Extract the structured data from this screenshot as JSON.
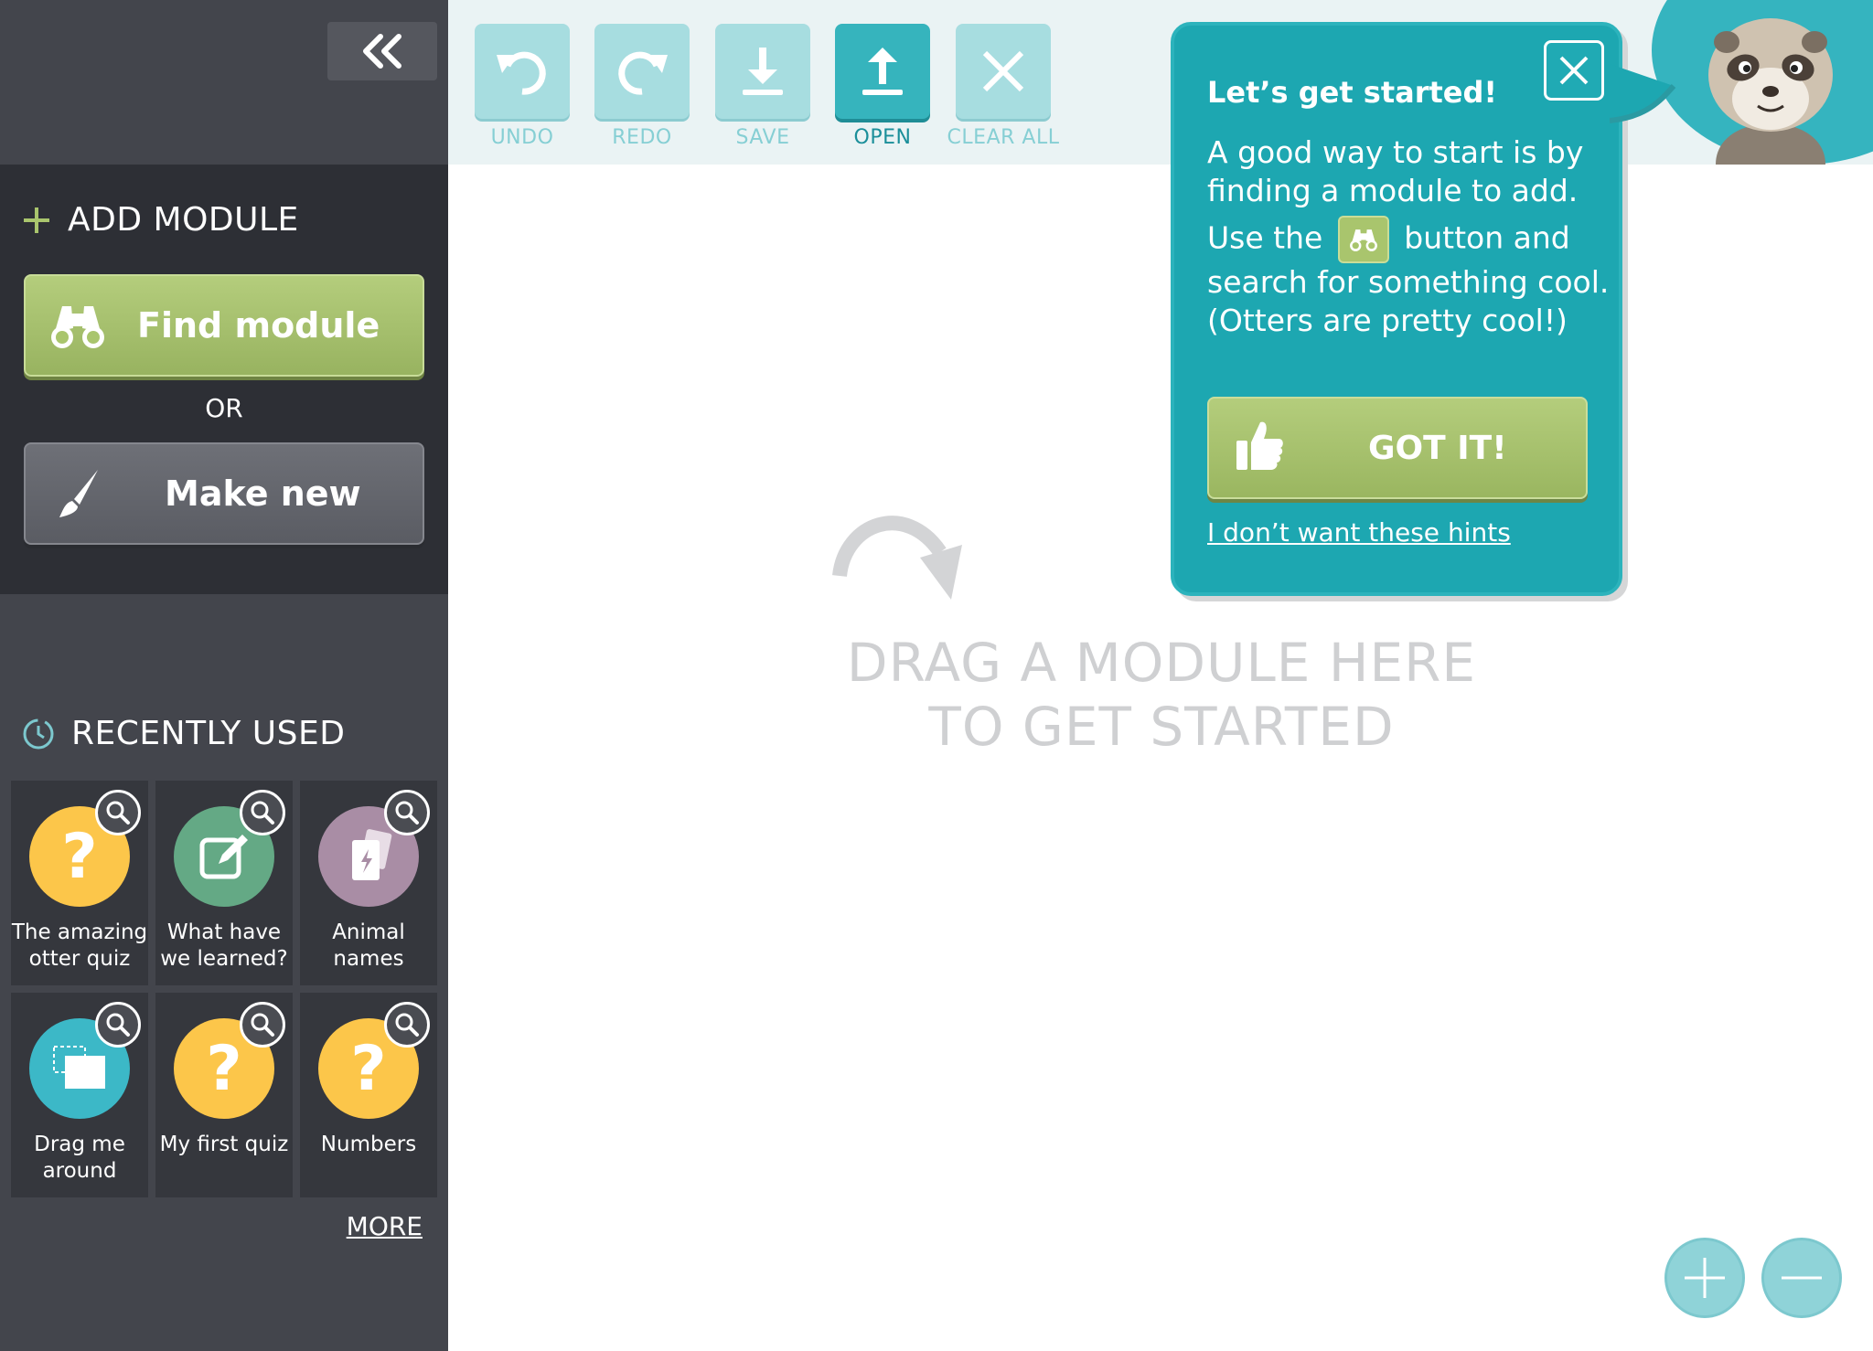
{
  "sidebar": {
    "collapse_icon": "double-chevron-left-icon",
    "add_module": {
      "title": "ADD MODULE",
      "find_label": "Find module",
      "or_label": "OR",
      "make_label": "Make new"
    },
    "recent": {
      "title": "RECENTLY USED",
      "items": [
        {
          "label": "The amazing otter quiz",
          "icon": "question-mark-icon",
          "color": "#fcc64a"
        },
        {
          "label": "What have we learned?",
          "icon": "edit-note-icon",
          "color": "#64a985"
        },
        {
          "label": "Animal names",
          "icon": "flashcards-icon",
          "color": "#a98da5"
        },
        {
          "label": "Drag me around",
          "icon": "drag-drop-icon",
          "color": "#3cb8c7"
        },
        {
          "label": "My first quiz",
          "icon": "question-mark-icon",
          "color": "#fcc64a"
        },
        {
          "label": "Numbers",
          "icon": "question-mark-icon",
          "color": "#fcc64a"
        }
      ],
      "more_label": "MORE"
    }
  },
  "toolbar": {
    "undo": "UNDO",
    "redo": "REDO",
    "save": "SAVE",
    "open": "OPEN",
    "clear_all": "CLEAR ALL"
  },
  "canvas": {
    "drop_line1": "DRAG A MODULE HERE",
    "drop_line2": "TO GET STARTED"
  },
  "hint": {
    "title": "Let’s get started!",
    "p1": "A good way to start is by finding a module to add.",
    "p2_before": "Use the",
    "p2_after": "button and search for something cool. (Otters are pretty cool!)",
    "got_it": "GOT IT!",
    "no_hints": "I don’t want these hints"
  },
  "colors": {
    "sidebar_bg": "#43454c",
    "accent_teal": "#1da7b1",
    "green_button": "#a9c56d"
  }
}
